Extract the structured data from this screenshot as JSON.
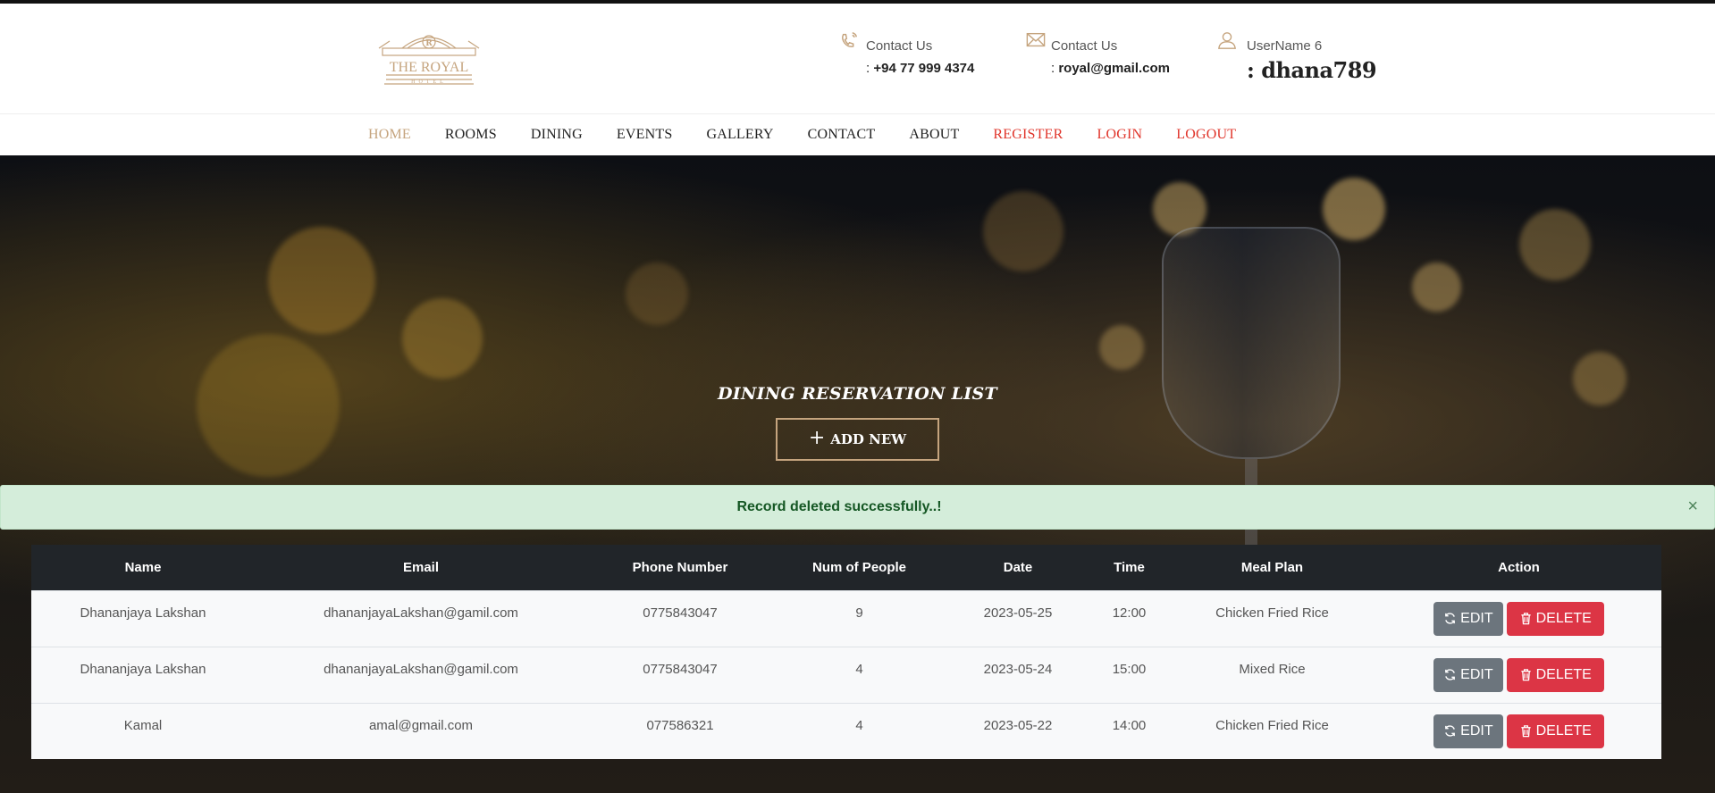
{
  "header": {
    "logo_text": "THE ROYAL",
    "logo_sub": "HOTEL",
    "logo_mark": "R",
    "phone": {
      "label": "Contact Us",
      "value": "+94 77 999 4374",
      "icon": "phone-icon"
    },
    "email": {
      "label": "Contact Us",
      "value": "royal@gmail.com",
      "icon": "envelope-icon"
    },
    "user": {
      "label": "UserName 6",
      "value": "dhana789",
      "icon": "user-icon"
    },
    "colon": ": "
  },
  "nav": {
    "items": [
      "HOME",
      "ROOMS",
      "DINING",
      "EVENTS",
      "GALLERY",
      "CONTACT",
      "ABOUT",
      "REGISTER",
      "LOGIN",
      "LOGOUT"
    ]
  },
  "hero": {
    "title": "DINING RESERVATION LIST",
    "add_button": "ADD NEW",
    "add_icon": "+"
  },
  "alert": {
    "message": "Record deleted successfully..!",
    "close": "×"
  },
  "table": {
    "headers": [
      "Name",
      "Email",
      "Phone Number",
      "Num of People",
      "Date",
      "Time",
      "Meal Plan",
      "Action"
    ],
    "rows": [
      [
        "Dhananjaya Lakshan",
        "dhananjayaLakshan@gamil.com",
        "0775843047",
        "9",
        "2023-05-25",
        "12:00",
        "Chicken Fried Rice"
      ],
      [
        "Dhananjaya Lakshan",
        "dhananjayaLakshan@gamil.com",
        "0775843047",
        "4",
        "2023-05-24",
        "15:00",
        "Mixed Rice"
      ],
      [
        "Kamal",
        "amal@gmail.com",
        "077586321",
        "4",
        "2023-05-22",
        "14:00",
        "Chicken Fried Rice"
      ]
    ],
    "edit_label": "EDIT",
    "delete_label": "DELETE"
  },
  "colors": {
    "gold": "#c5a47e",
    "red": "#e0352b",
    "edit": "#6c757d",
    "delete": "#dc3545",
    "alert_bg": "#d4edda"
  }
}
